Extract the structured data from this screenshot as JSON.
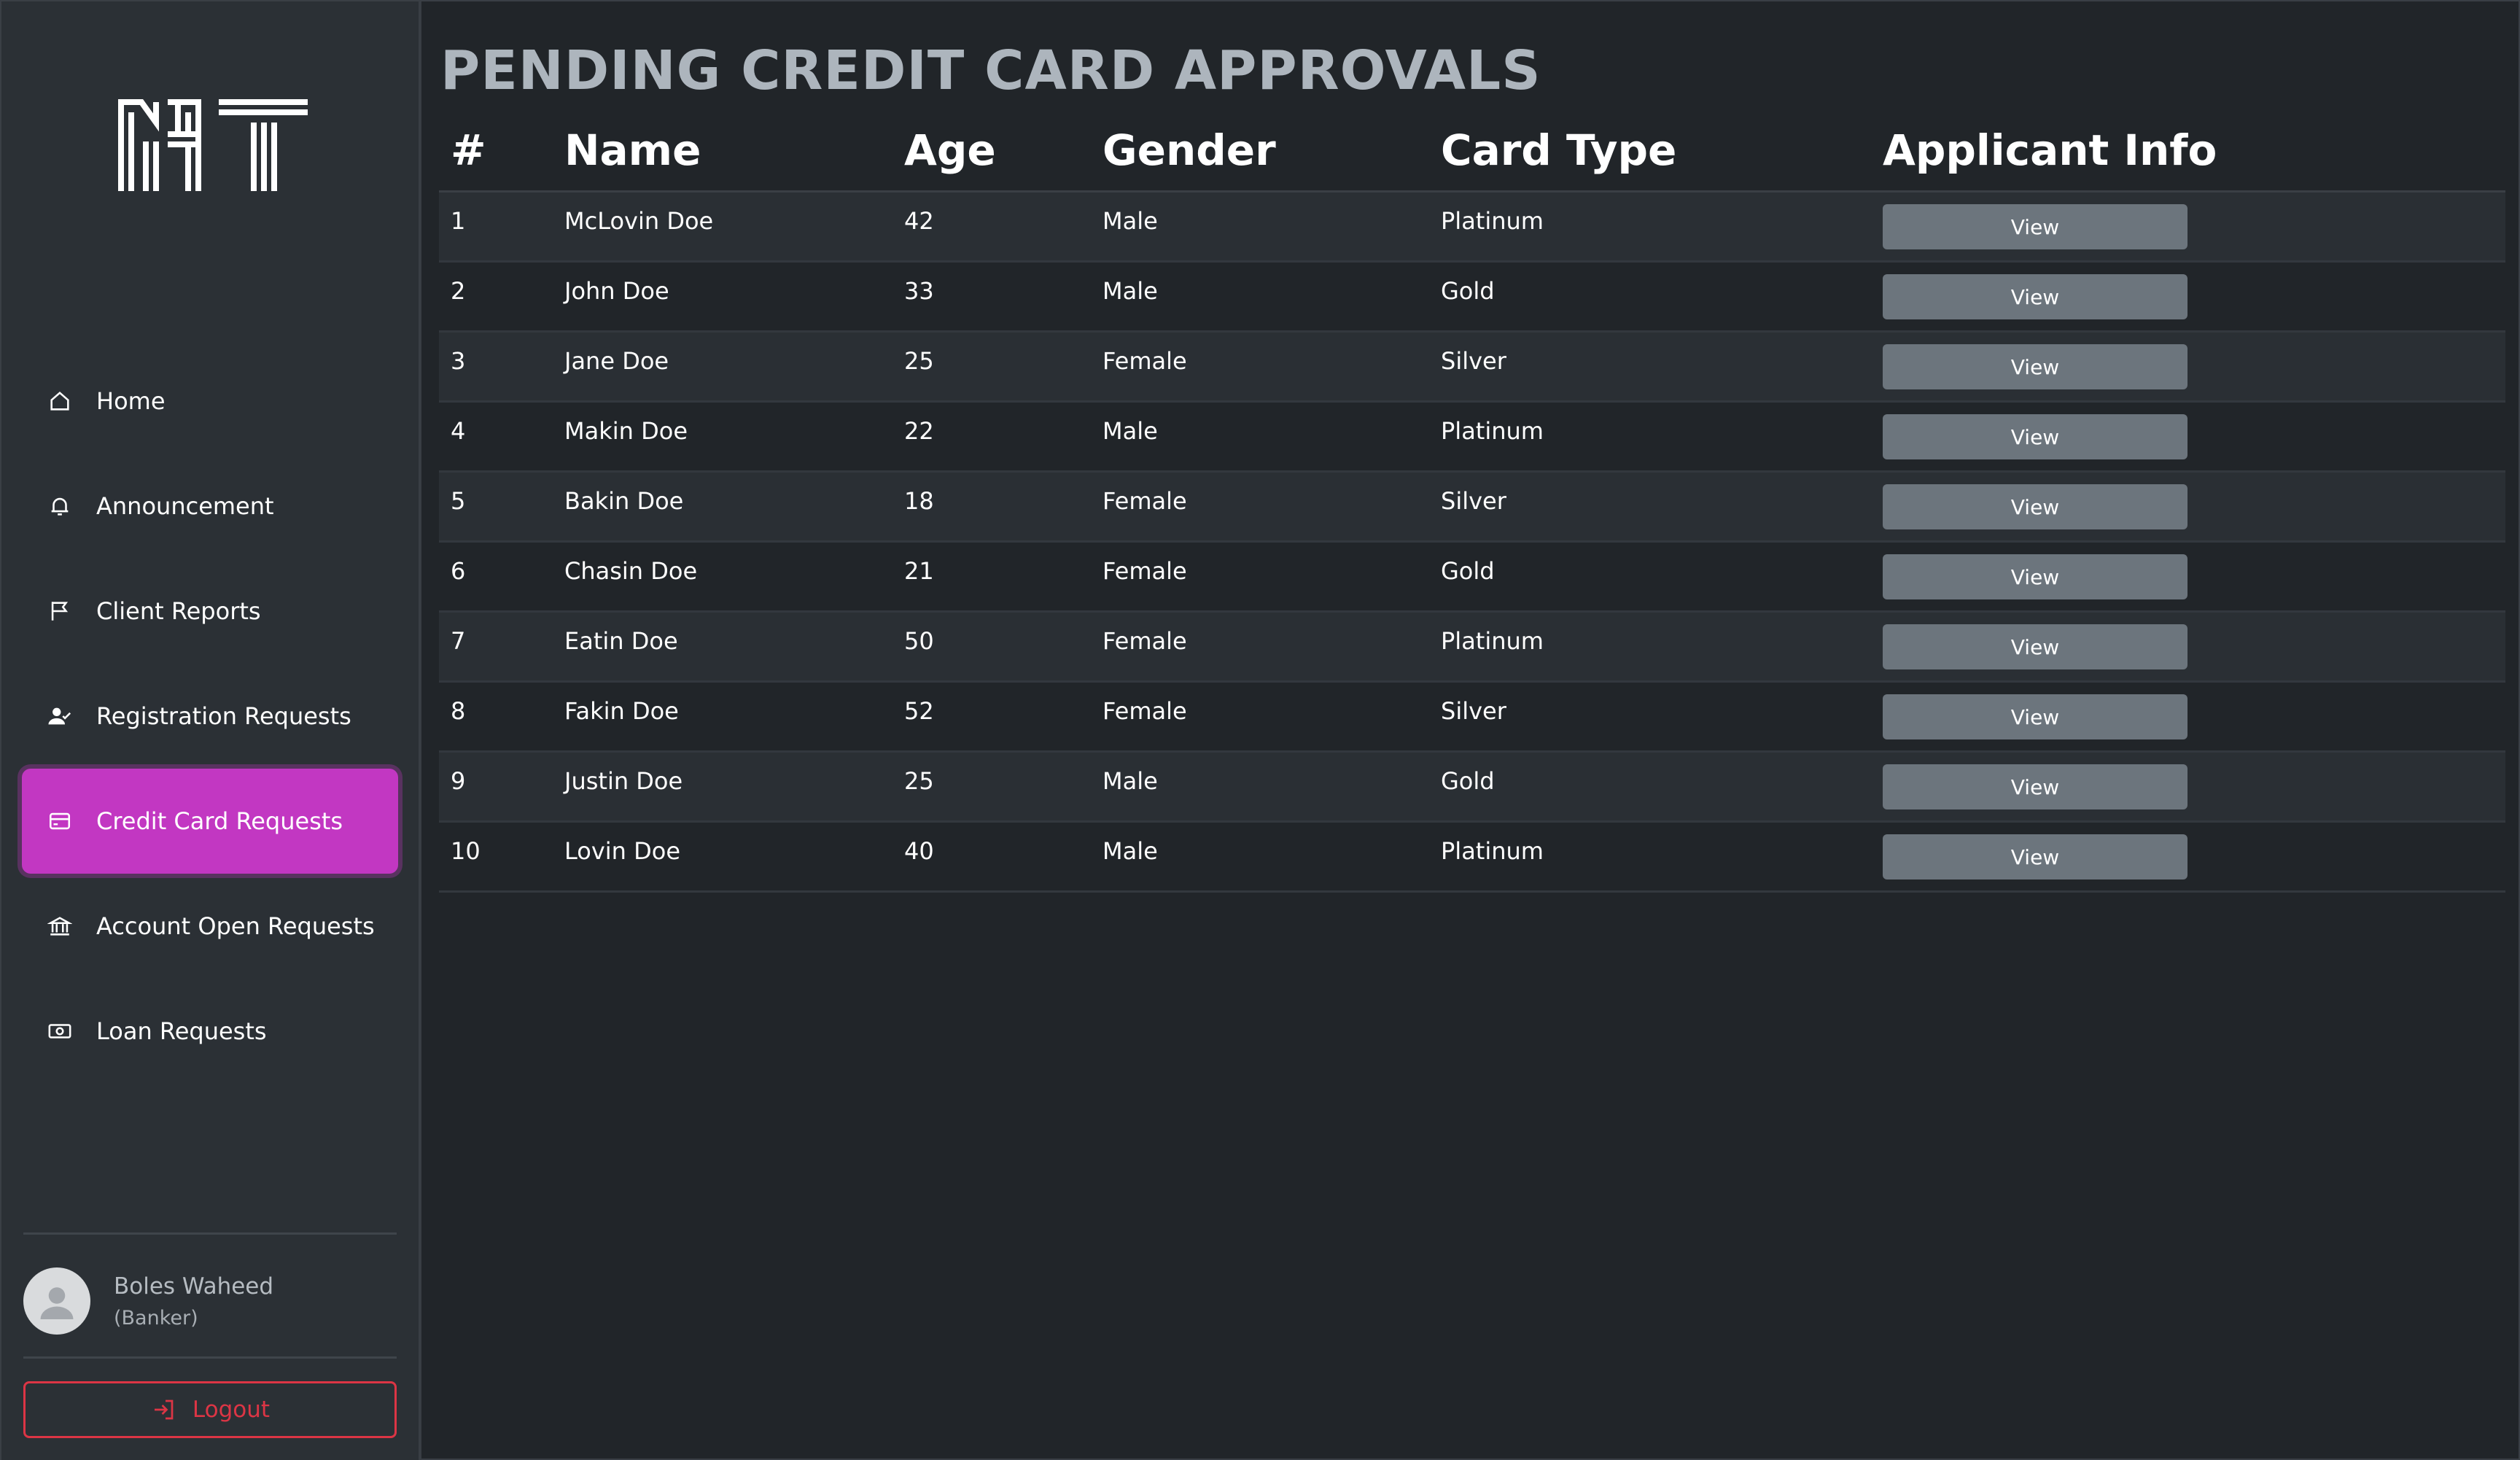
{
  "sidebar": {
    "items": [
      {
        "label": "Home",
        "icon": "home-icon",
        "active": false
      },
      {
        "label": "Announcement",
        "icon": "bell-icon",
        "active": false
      },
      {
        "label": "Client Reports",
        "icon": "flag-icon",
        "active": false
      },
      {
        "label": "Registration Requests",
        "icon": "user-check-icon",
        "active": false
      },
      {
        "label": "Credit Card Requests",
        "icon": "credit-card-icon",
        "active": true
      },
      {
        "label": "Account Open Requests",
        "icon": "bank-icon",
        "active": false
      },
      {
        "label": "Loan Requests",
        "icon": "cash-icon",
        "active": false
      }
    ],
    "user": {
      "name": "Boles Waheed",
      "role": "(Banker)"
    },
    "logout_label": "Logout"
  },
  "main": {
    "title": "PENDING CREDIT CARD APPROVALS",
    "columns": [
      "#",
      "Name",
      "Age",
      "Gender",
      "Card Type",
      "Applicant Info"
    ],
    "rows": [
      {
        "n": "1",
        "name": "McLovin Doe",
        "age": "42",
        "gender": "Male",
        "card": "Platinum",
        "action": "View"
      },
      {
        "n": "2",
        "name": "John Doe",
        "age": "33",
        "gender": "Male",
        "card": "Gold",
        "action": "View"
      },
      {
        "n": "3",
        "name": "Jane Doe",
        "age": "25",
        "gender": "Female",
        "card": "Silver",
        "action": "View"
      },
      {
        "n": "4",
        "name": "Makin Doe",
        "age": "22",
        "gender": "Male",
        "card": "Platinum",
        "action": "View"
      },
      {
        "n": "5",
        "name": "Bakin Doe",
        "age": "18",
        "gender": "Female",
        "card": "Silver",
        "action": "View"
      },
      {
        "n": "6",
        "name": "Chasin Doe",
        "age": "21",
        "gender": "Female",
        "card": "Gold",
        "action": "View"
      },
      {
        "n": "7",
        "name": "Eatin Doe",
        "age": "50",
        "gender": "Female",
        "card": "Platinum",
        "action": "View"
      },
      {
        "n": "8",
        "name": "Fakin Doe",
        "age": "52",
        "gender": "Female",
        "card": "Silver",
        "action": "View"
      },
      {
        "n": "9",
        "name": "Justin Doe",
        "age": "25",
        "gender": "Male",
        "card": "Gold",
        "action": "View"
      },
      {
        "n": "10",
        "name": "Lovin Doe",
        "age": "40",
        "gender": "Male",
        "card": "Platinum",
        "action": "View"
      }
    ]
  },
  "colors": {
    "background": "#212529",
    "sidebar": "#2b3035",
    "accent": "#c237c2",
    "button": "#6c757d",
    "danger": "#dc3545"
  }
}
